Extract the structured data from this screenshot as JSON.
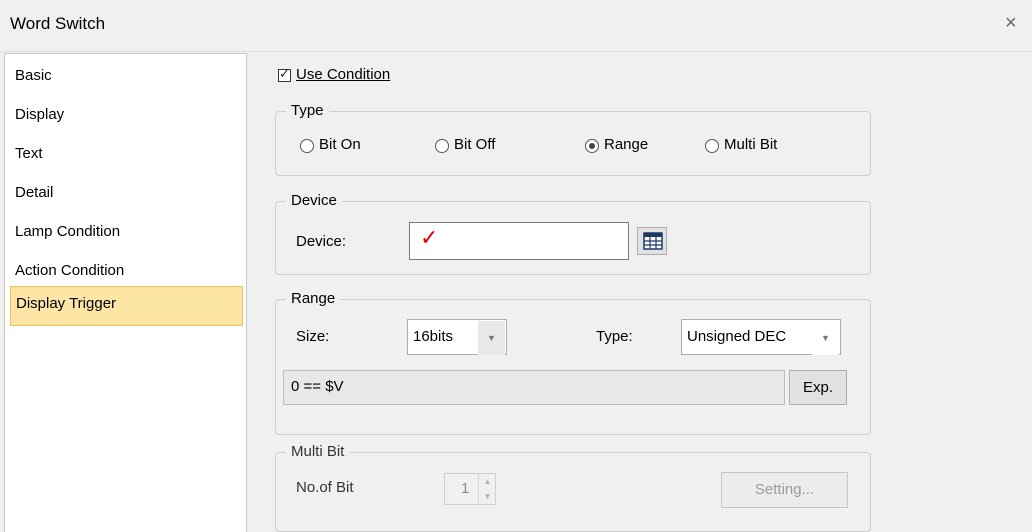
{
  "window": {
    "title": "Word Switch",
    "close_glyph": "×"
  },
  "sidebar": {
    "items": [
      {
        "label": "Basic"
      },
      {
        "label": "Display"
      },
      {
        "label": "Text"
      },
      {
        "label": "Detail"
      },
      {
        "label": "Lamp Condition"
      },
      {
        "label": "Action Condition"
      },
      {
        "label": "Display Trigger"
      }
    ],
    "selected": "Display Trigger"
  },
  "use_condition": {
    "label": "Use Condition",
    "checked": true
  },
  "type_group": {
    "legend": "Type",
    "options": [
      {
        "label": "Bit On",
        "checked": false
      },
      {
        "label": "Bit Off",
        "checked": false
      },
      {
        "label": "Range",
        "checked": true
      },
      {
        "label": "Multi Bit",
        "checked": false
      }
    ]
  },
  "device_group": {
    "legend": "Device",
    "label": "Device:",
    "value_glyph": "✓",
    "browse_icon": "device-browse-icon"
  },
  "range_group": {
    "legend": "Range",
    "size_label": "Size:",
    "size_value": "16bits",
    "type_label": "Type:",
    "type_value": "Unsigned DEC",
    "expression": "0 == $V",
    "exp_button": "Exp."
  },
  "multibit_group": {
    "legend": "Multi Bit",
    "count_label": "No.of Bit",
    "count_value": "1",
    "setting_button": "Setting..."
  },
  "colors": {
    "selected_bg": "#fde5a5",
    "selected_border": "#f0c160",
    "check_red": "#e00000"
  }
}
